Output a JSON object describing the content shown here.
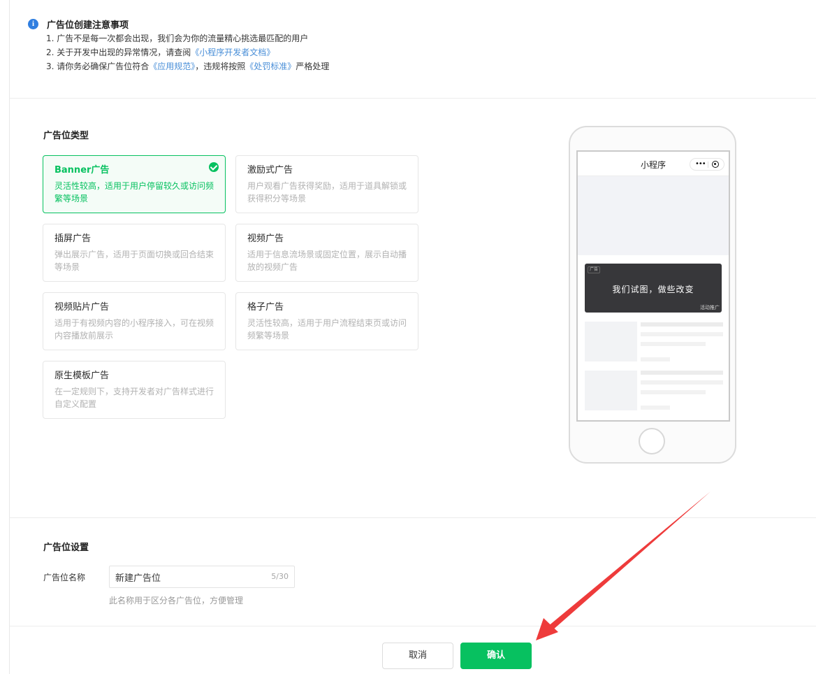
{
  "notice": {
    "title": "广告位创建注意事项",
    "line1": "1. 广告不是每一次都会出现，我们会为你的流量精心挑选最匹配的用户",
    "line2_prefix": "2. 关于开发中出现的异常情况，请查阅",
    "line2_link": "《小程序开发者文档》",
    "line3_prefix": "3. 请你务必确保广告位符合",
    "line3_link1": "《应用规范》",
    "line3_mid": "，违规将按照",
    "line3_link2": "《处罚标准》",
    "line3_suffix": "严格处理"
  },
  "ad_types": {
    "section_title": "广告位类型",
    "items": [
      {
        "title": "Banner广告",
        "desc": "灵活性较高，适用于用户停留较久或访问频繁等场景",
        "selected": true
      },
      {
        "title": "激励式广告",
        "desc": "用户观看广告获得奖励，适用于道具解锁或获得积分等场景",
        "selected": false
      },
      {
        "title": "插屏广告",
        "desc": "弹出展示广告，适用于页面切换或回合结束等场景",
        "selected": false
      },
      {
        "title": "视频广告",
        "desc": "适用于信息流场景或固定位置，展示自动播放的视频广告",
        "selected": false
      },
      {
        "title": "视频贴片广告",
        "desc": "适用于有视频内容的小程序接入，可在视频内容播放前展示",
        "selected": false
      },
      {
        "title": "格子广告",
        "desc": "灵活性较高，适用于用户流程结束页或访问频繁等场景",
        "selected": false
      },
      {
        "title": "原生模板广告",
        "desc": "在一定规则下，支持开发者对广告样式进行自定义配置",
        "selected": false
      }
    ]
  },
  "preview": {
    "nav_title": "小程序",
    "more_glyph": "•••",
    "ad_tag": "广告",
    "banner_text": "我们试图，做些改变",
    "banner_sub": "活动推广"
  },
  "settings": {
    "section_title": "广告位设置",
    "name_label": "广告位名称",
    "name_value": "新建广告位",
    "counter": "5/30",
    "hint": "此名称用于区分各广告位，方便管理"
  },
  "footer": {
    "cancel_label": "取消",
    "confirm_label": "确认"
  },
  "colors": {
    "brand_green": "#07c160",
    "link_blue": "#4a8fd8",
    "annotation_red": "#ee3b3b"
  }
}
